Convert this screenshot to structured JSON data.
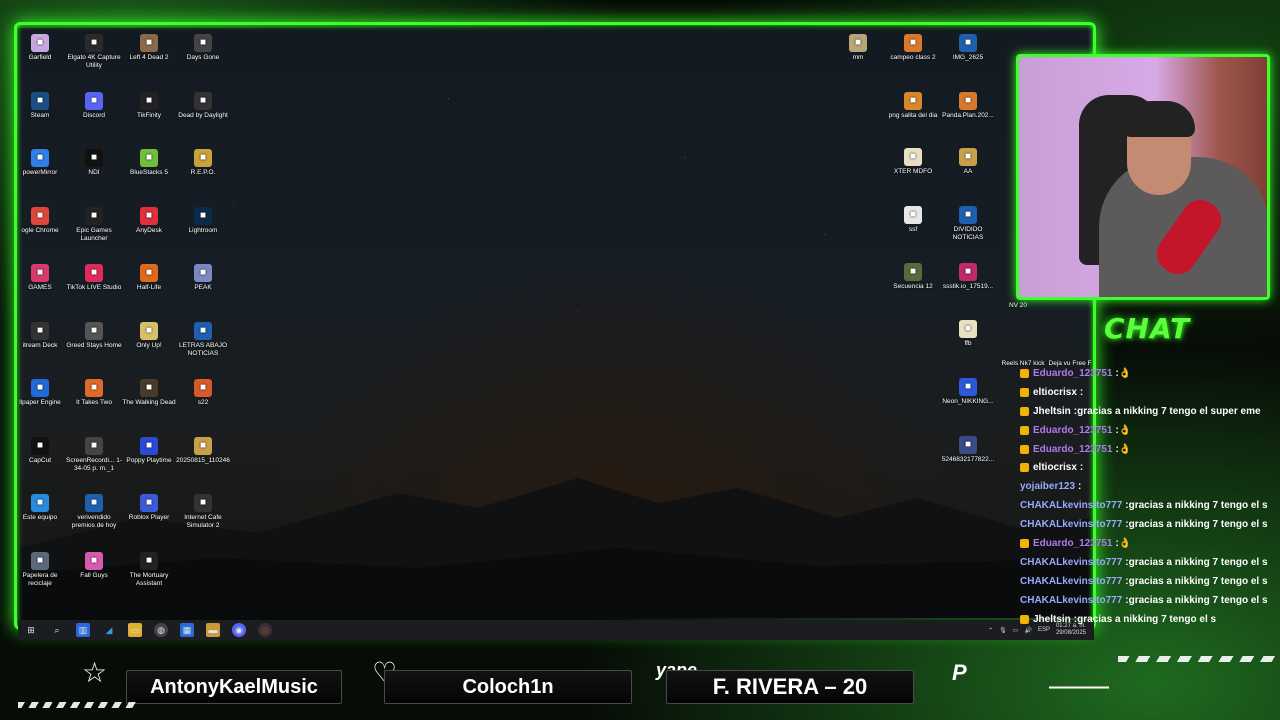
{
  "desktop": {
    "left_icons": [
      {
        "label": "Garfield",
        "icon": "garfield-icon",
        "color": "#c9a5e0"
      },
      {
        "label": "Elgato 4K Capture Utility",
        "icon": "elgato-icon",
        "color": "#2a2a2a"
      },
      {
        "label": "Left 4 Dead 2",
        "icon": "l4d2-icon",
        "color": "#8a6a4a"
      },
      {
        "label": "Days Gone",
        "icon": "daysgone-icon",
        "color": "#444"
      },
      {
        "label": "Steam",
        "icon": "steam-icon",
        "color": "#1b4e86"
      },
      {
        "label": "Discord",
        "icon": "discord-icon",
        "color": "#5865f2"
      },
      {
        "label": "TikFinity",
        "icon": "tikfinity-icon",
        "color": "#222"
      },
      {
        "label": "Dead by Daylight",
        "icon": "dbd-icon",
        "color": "#333"
      },
      {
        "label": "powerMirror",
        "icon": "powermirror-icon",
        "color": "#2f7fe6"
      },
      {
        "label": "NDI",
        "icon": "ndi-icon",
        "color": "#111"
      },
      {
        "label": "BlueStacks 5",
        "icon": "bluestacks-icon",
        "color": "#6fbf3a"
      },
      {
        "label": "R.E.P.O.",
        "icon": "repo-icon",
        "color": "#c9a23a"
      },
      {
        "label": "ogle Chrome",
        "icon": "chrome-icon",
        "color": "#e0453a"
      },
      {
        "label": "Epic Games Launcher",
        "icon": "epic-icon",
        "color": "#222"
      },
      {
        "label": "AnyDesk",
        "icon": "anydesk-icon",
        "color": "#e0303a"
      },
      {
        "label": "Lightroom",
        "icon": "lightroom-icon",
        "color": "#0b2a4a"
      },
      {
        "label": "GAMES",
        "icon": "games-icon",
        "color": "#d83a6a"
      },
      {
        "label": "TikTok LIVE Studio",
        "icon": "tiktok-live-icon",
        "color": "#e02a5a"
      },
      {
        "label": "Half-Life",
        "icon": "halflife-icon",
        "color": "#e06a1a"
      },
      {
        "label": "PEAK",
        "icon": "peak-icon",
        "color": "#7a8ac0"
      },
      {
        "label": "itream Deck",
        "icon": "streamdeck-icon",
        "color": "#333"
      },
      {
        "label": "Greed Stays Home",
        "icon": "greed-icon",
        "color": "#555"
      },
      {
        "label": "Only Up!",
        "icon": "onlyup-icon",
        "color": "#d8c06a"
      },
      {
        "label": "LETRAS ABAJO NOTICIAS",
        "icon": "ps-file-icon",
        "color": "#1f5fb0"
      },
      {
        "label": "llpaper Engine",
        "icon": "wallpaper-engine-icon",
        "color": "#1f6ad8"
      },
      {
        "label": "It Takes Two",
        "icon": "ittakestwo-icon",
        "color": "#e06a2a"
      },
      {
        "label": "The Walking Dead",
        "icon": "twd-icon",
        "color": "#4a3a2a"
      },
      {
        "label": "s22",
        "icon": "s22-icon",
        "color": "#d85a2a"
      },
      {
        "label": "CapCut",
        "icon": "capcut-icon",
        "color": "#111"
      },
      {
        "label": "ScreenRecordi... 1-34-05 p. m._1",
        "icon": "video-file-icon",
        "color": "#444"
      },
      {
        "label": "Poppy Playtime",
        "icon": "poppy-icon",
        "color": "#2a4ad8"
      },
      {
        "label": "20250815_110246",
        "icon": "image-file-icon",
        "color": "#c8a04a"
      },
      {
        "label": "Este equipo",
        "icon": "computer-icon",
        "color": "#2a8ae0"
      },
      {
        "label": "verivendido premios de hoy",
        "icon": "ps-file-icon",
        "color": "#1f5fb0"
      },
      {
        "label": "Roblox Player",
        "icon": "roblox-icon",
        "color": "#3a5ad8"
      },
      {
        "label": "Internet Cafe Simulator 2",
        "icon": "ics2-icon",
        "color": "#333"
      },
      {
        "label": "Papelera de reciclaje",
        "icon": "recycle-bin-icon",
        "color": "#5a6a7a"
      },
      {
        "label": "Fall Guys",
        "icon": "fallguys-icon",
        "color": "#d85ab0"
      },
      {
        "label": "The Mortuary Assistant",
        "icon": "mortuary-icon",
        "color": "#222"
      }
    ],
    "right_icons": [
      {
        "label": "mm",
        "icon": "file-icon",
        "color": "#b8a67a"
      },
      {
        "label": "campeo class 2",
        "icon": "image-file-icon",
        "color": "#d87a2a"
      },
      {
        "label": "IMG_2625",
        "icon": "ps-file-icon",
        "color": "#1f5fb0"
      },
      {
        "label": "png salita del dia",
        "icon": "image-file-icon",
        "color": "#d8882a"
      },
      {
        "label": "Panda.Plan.202...",
        "icon": "image-file-icon",
        "color": "#d8782a"
      },
      {
        "label": "XTER MDFO",
        "icon": "doc-file-icon",
        "color": "#e8e0c0"
      },
      {
        "label": "AA",
        "icon": "image-file-icon",
        "color": "#c8a04a"
      },
      {
        "label": "ssf",
        "icon": "doc-file-icon",
        "color": "#e8e8e8"
      },
      {
        "label": "DIVIDIDO NOTICIAS",
        "icon": "ps-file-icon",
        "color": "#1f5fb0"
      },
      {
        "label": "Secuencia 12",
        "icon": "video-file-icon",
        "color": "#5a6a3a"
      },
      {
        "label": "ssstik.io_17519...",
        "icon": "video-file-icon",
        "color": "#c02a6a"
      },
      {
        "label": "ffb",
        "icon": "doc-file-icon",
        "color": "#e8e0c0"
      },
      {
        "label": "Neon_NIKKING...",
        "icon": "image-file-icon",
        "color": "#2a5ad8"
      },
      {
        "label": "5246832177822...",
        "icon": "image-file-icon",
        "color": "#3a4a8a"
      }
    ],
    "partial_labels": [
      "NV 20",
      "Reels Nk7 kick",
      "Deja vu Free F"
    ]
  },
  "taskbar": {
    "items": [
      "windows-icon",
      "search-icon",
      "taskview-icon",
      "edge-icon",
      "explorer-icon",
      "chrome-icon",
      "store-icon",
      "folder-icon",
      "discord-icon",
      "obs-icon"
    ],
    "tray": {
      "lang": "ESP",
      "time": "01:27 a. m.",
      "date": "29/08/2025"
    }
  },
  "chat": {
    "title": "CHAT",
    "messages": [
      {
        "user": "Eduardo_123751",
        "text": "👌",
        "color": "#b07af0",
        "badge": true
      },
      {
        "user": "eltiocrisx",
        "text": "",
        "color": "#ffffff",
        "badge": true
      },
      {
        "user": "Jheltsin",
        "text": "gracias a nikking 7 tengo el super eme",
        "color": "#ffffff",
        "badge": true
      },
      {
        "user": "Eduardo_123751",
        "text": "👌",
        "color": "#b07af0",
        "badge": true
      },
      {
        "user": "Eduardo_123751",
        "text": "👌",
        "color": "#b07af0",
        "badge": true
      },
      {
        "user": "eltiocrisx",
        "text": "",
        "color": "#ffffff",
        "badge": true
      },
      {
        "user": "yojaiber123",
        "text": "",
        "color": "#9aa8ff",
        "badge": false
      },
      {
        "user": "CHAKALkevinsito777",
        "text": "gracias a nikking 7 tengo el s",
        "color": "#9aa8ff",
        "badge": false
      },
      {
        "user": "CHAKALkevinsito777",
        "text": "gracias a nikking 7 tengo el s",
        "color": "#9aa8ff",
        "badge": false
      },
      {
        "user": "Eduardo_123751",
        "text": "👌",
        "color": "#b07af0",
        "badge": true
      },
      {
        "user": "CHAKALkevinsito777",
        "text": "gracias a nikking 7 tengo el s",
        "color": "#9aa8ff",
        "badge": false
      },
      {
        "user": "CHAKALkevinsito777",
        "text": "gracias a nikking 7 tengo el s",
        "color": "#9aa8ff",
        "badge": false
      },
      {
        "user": "CHAKALkevinsito777",
        "text": "gracias a nikking 7 tengo el s",
        "color": "#9aa8ff",
        "badge": false
      },
      {
        "user": "Jheltsin",
        "text": "gracias a nikking 7 tengo el s",
        "color": "#ffffff",
        "badge": true
      }
    ]
  },
  "bottom_bar": {
    "follower": "AntonyKaelMusic",
    "subscriber": "Coloch1n",
    "yape_label": "yape",
    "donation": "F. RIVERA – 20",
    "paypal_placeholder": "———"
  }
}
